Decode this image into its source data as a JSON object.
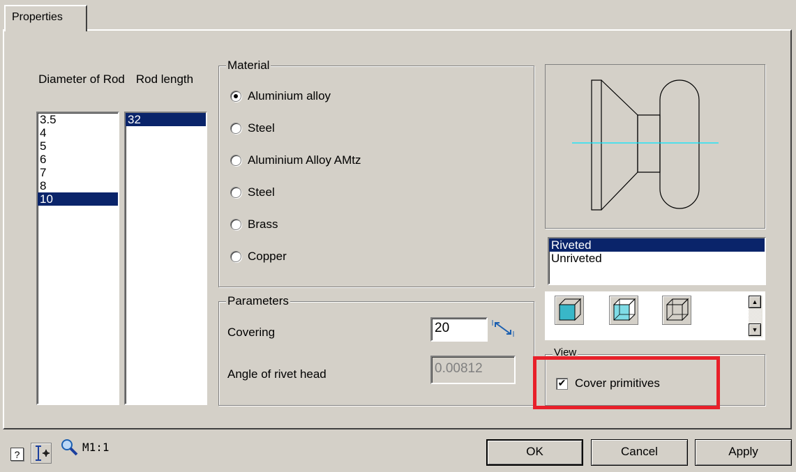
{
  "tab": {
    "label": "Properties"
  },
  "columns": {
    "diameter_header": "Diameter of Rod",
    "rod_length_header": "Rod length"
  },
  "diameters": [
    "3.5",
    "4",
    "5",
    "6",
    "7",
    "8",
    "10"
  ],
  "diameter_selected": "10",
  "rod_lengths": [
    "32"
  ],
  "rod_length_selected": "32",
  "material": {
    "label": "Material",
    "options": [
      "Aluminium alloy",
      "Steel",
      "Aluminium Alloy AMtz",
      "Steel",
      "Brass",
      "Copper"
    ],
    "selected": "Aluminium alloy"
  },
  "parameters": {
    "label": "Parameters",
    "covering_label": "Covering",
    "covering_value": "20",
    "angle_label": "Angle of rivet head",
    "angle_value": "0.00812"
  },
  "type_list": {
    "items": [
      "Riveted",
      "Unriveted"
    ],
    "selected": "Riveted"
  },
  "view": {
    "label": "View",
    "cover_primitives_label": "Cover primitives",
    "cover_primitives_checked": true,
    "highlight_color": "#e8202a"
  },
  "status": {
    "scale": "M1:1"
  },
  "buttons": {
    "ok": "OK",
    "cancel": "Cancel",
    "apply": "Apply"
  },
  "colors": {
    "face": "#d4d0c8",
    "selection": "#0a246a",
    "axis_line": "#00e5ff",
    "cube_fill": "#39b7c8"
  }
}
